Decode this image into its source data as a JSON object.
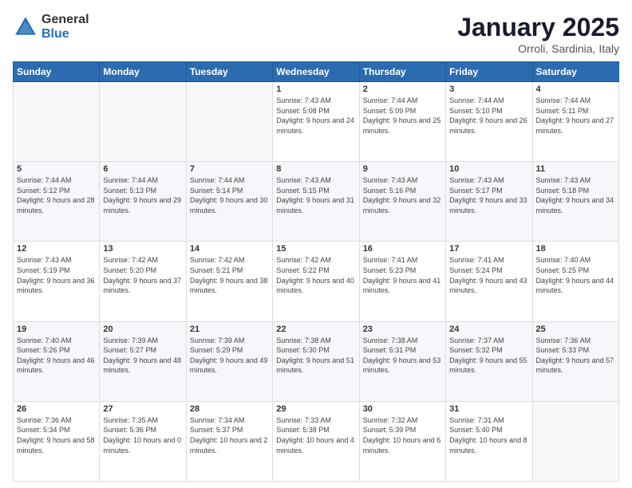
{
  "logo": {
    "general": "General",
    "blue": "Blue"
  },
  "title": "January 2025",
  "location": "Orroli, Sardinia, Italy",
  "weekdays": [
    "Sunday",
    "Monday",
    "Tuesday",
    "Wednesday",
    "Thursday",
    "Friday",
    "Saturday"
  ],
  "weeks": [
    [
      {
        "day": "",
        "sunrise": "",
        "sunset": "",
        "daylight": ""
      },
      {
        "day": "",
        "sunrise": "",
        "sunset": "",
        "daylight": ""
      },
      {
        "day": "",
        "sunrise": "",
        "sunset": "",
        "daylight": ""
      },
      {
        "day": "1",
        "sunrise": "Sunrise: 7:43 AM",
        "sunset": "Sunset: 5:08 PM",
        "daylight": "Daylight: 9 hours and 24 minutes."
      },
      {
        "day": "2",
        "sunrise": "Sunrise: 7:44 AM",
        "sunset": "Sunset: 5:09 PM",
        "daylight": "Daylight: 9 hours and 25 minutes."
      },
      {
        "day": "3",
        "sunrise": "Sunrise: 7:44 AM",
        "sunset": "Sunset: 5:10 PM",
        "daylight": "Daylight: 9 hours and 26 minutes."
      },
      {
        "day": "4",
        "sunrise": "Sunrise: 7:44 AM",
        "sunset": "Sunset: 5:11 PM",
        "daylight": "Daylight: 9 hours and 27 minutes."
      }
    ],
    [
      {
        "day": "5",
        "sunrise": "Sunrise: 7:44 AM",
        "sunset": "Sunset: 5:12 PM",
        "daylight": "Daylight: 9 hours and 28 minutes."
      },
      {
        "day": "6",
        "sunrise": "Sunrise: 7:44 AM",
        "sunset": "Sunset: 5:13 PM",
        "daylight": "Daylight: 9 hours and 29 minutes."
      },
      {
        "day": "7",
        "sunrise": "Sunrise: 7:44 AM",
        "sunset": "Sunset: 5:14 PM",
        "daylight": "Daylight: 9 hours and 30 minutes."
      },
      {
        "day": "8",
        "sunrise": "Sunrise: 7:43 AM",
        "sunset": "Sunset: 5:15 PM",
        "daylight": "Daylight: 9 hours and 31 minutes."
      },
      {
        "day": "9",
        "sunrise": "Sunrise: 7:43 AM",
        "sunset": "Sunset: 5:16 PM",
        "daylight": "Daylight: 9 hours and 32 minutes."
      },
      {
        "day": "10",
        "sunrise": "Sunrise: 7:43 AM",
        "sunset": "Sunset: 5:17 PM",
        "daylight": "Daylight: 9 hours and 33 minutes."
      },
      {
        "day": "11",
        "sunrise": "Sunrise: 7:43 AM",
        "sunset": "Sunset: 5:18 PM",
        "daylight": "Daylight: 9 hours and 34 minutes."
      }
    ],
    [
      {
        "day": "12",
        "sunrise": "Sunrise: 7:43 AM",
        "sunset": "Sunset: 5:19 PM",
        "daylight": "Daylight: 9 hours and 36 minutes."
      },
      {
        "day": "13",
        "sunrise": "Sunrise: 7:42 AM",
        "sunset": "Sunset: 5:20 PM",
        "daylight": "Daylight: 9 hours and 37 minutes."
      },
      {
        "day": "14",
        "sunrise": "Sunrise: 7:42 AM",
        "sunset": "Sunset: 5:21 PM",
        "daylight": "Daylight: 9 hours and 38 minutes."
      },
      {
        "day": "15",
        "sunrise": "Sunrise: 7:42 AM",
        "sunset": "Sunset: 5:22 PM",
        "daylight": "Daylight: 9 hours and 40 minutes."
      },
      {
        "day": "16",
        "sunrise": "Sunrise: 7:41 AM",
        "sunset": "Sunset: 5:23 PM",
        "daylight": "Daylight: 9 hours and 41 minutes."
      },
      {
        "day": "17",
        "sunrise": "Sunrise: 7:41 AM",
        "sunset": "Sunset: 5:24 PM",
        "daylight": "Daylight: 9 hours and 43 minutes."
      },
      {
        "day": "18",
        "sunrise": "Sunrise: 7:40 AM",
        "sunset": "Sunset: 5:25 PM",
        "daylight": "Daylight: 9 hours and 44 minutes."
      }
    ],
    [
      {
        "day": "19",
        "sunrise": "Sunrise: 7:40 AM",
        "sunset": "Sunset: 5:26 PM",
        "daylight": "Daylight: 9 hours and 46 minutes."
      },
      {
        "day": "20",
        "sunrise": "Sunrise: 7:39 AM",
        "sunset": "Sunset: 5:27 PM",
        "daylight": "Daylight: 9 hours and 48 minutes."
      },
      {
        "day": "21",
        "sunrise": "Sunrise: 7:39 AM",
        "sunset": "Sunset: 5:29 PM",
        "daylight": "Daylight: 9 hours and 49 minutes."
      },
      {
        "day": "22",
        "sunrise": "Sunrise: 7:38 AM",
        "sunset": "Sunset: 5:30 PM",
        "daylight": "Daylight: 9 hours and 51 minutes."
      },
      {
        "day": "23",
        "sunrise": "Sunrise: 7:38 AM",
        "sunset": "Sunset: 5:31 PM",
        "daylight": "Daylight: 9 hours and 53 minutes."
      },
      {
        "day": "24",
        "sunrise": "Sunrise: 7:37 AM",
        "sunset": "Sunset: 5:32 PM",
        "daylight": "Daylight: 9 hours and 55 minutes."
      },
      {
        "day": "25",
        "sunrise": "Sunrise: 7:36 AM",
        "sunset": "Sunset: 5:33 PM",
        "daylight": "Daylight: 9 hours and 57 minutes."
      }
    ],
    [
      {
        "day": "26",
        "sunrise": "Sunrise: 7:36 AM",
        "sunset": "Sunset: 5:34 PM",
        "daylight": "Daylight: 9 hours and 58 minutes."
      },
      {
        "day": "27",
        "sunrise": "Sunrise: 7:35 AM",
        "sunset": "Sunset: 5:36 PM",
        "daylight": "Daylight: 10 hours and 0 minutes."
      },
      {
        "day": "28",
        "sunrise": "Sunrise: 7:34 AM",
        "sunset": "Sunset: 5:37 PM",
        "daylight": "Daylight: 10 hours and 2 minutes."
      },
      {
        "day": "29",
        "sunrise": "Sunrise: 7:33 AM",
        "sunset": "Sunset: 5:38 PM",
        "daylight": "Daylight: 10 hours and 4 minutes."
      },
      {
        "day": "30",
        "sunrise": "Sunrise: 7:32 AM",
        "sunset": "Sunset: 5:39 PM",
        "daylight": "Daylight: 10 hours and 6 minutes."
      },
      {
        "day": "31",
        "sunrise": "Sunrise: 7:31 AM",
        "sunset": "Sunset: 5:40 PM",
        "daylight": "Daylight: 10 hours and 8 minutes."
      },
      {
        "day": "",
        "sunrise": "",
        "sunset": "",
        "daylight": ""
      }
    ]
  ]
}
